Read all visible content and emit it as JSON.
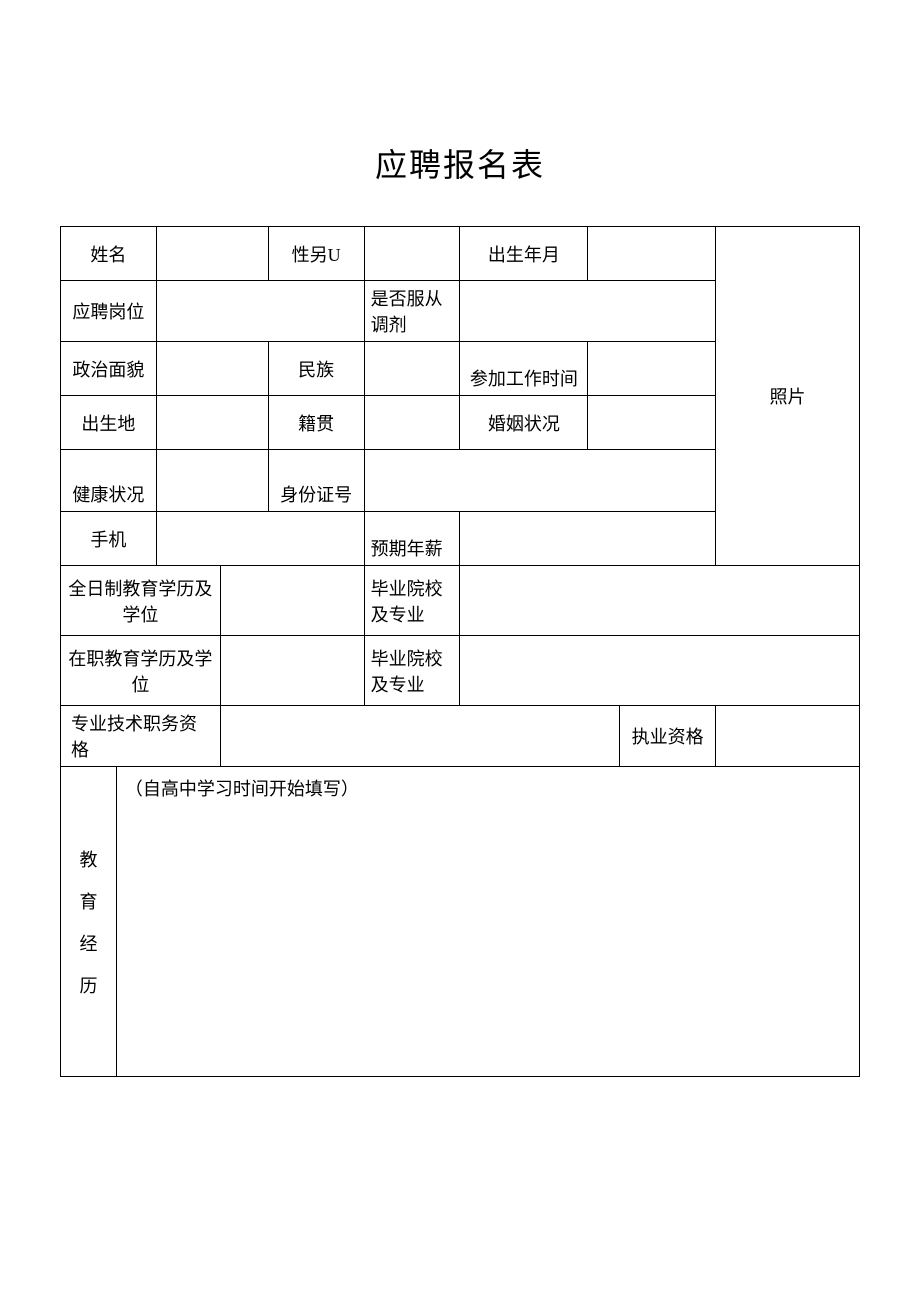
{
  "title": "应聘报名表",
  "labels": {
    "name": "姓名",
    "gender": "性另U",
    "birth": "出生年月",
    "position": "应聘岗位",
    "accept_transfer": "是否服从调剂",
    "political": "政治面貌",
    "ethnicity": "民族",
    "work_start": "参加工作时间",
    "birthplace": "出生地",
    "native_place": "籍贯",
    "marital": "婚姻状况",
    "health": "健康状况",
    "id_number": "身份证号",
    "mobile": "手机",
    "expected_salary": "预期年薪",
    "fulltime_edu": "全日制教育学历及学位",
    "grad_school": "毕业院校及专业",
    "onjob_edu": "在职教育学历及学位",
    "pro_title": "专业技术职务资格",
    "practice_qual": "执业资格",
    "edu_history": "教育经历",
    "edu_note": "（自高中学习时间开始填写）",
    "photo": "照片"
  },
  "values": {
    "name": "",
    "gender": "",
    "birth": "",
    "position": "",
    "accept_transfer": "",
    "political": "",
    "ethnicity": "",
    "work_start": "",
    "birthplace": "",
    "native_place": "",
    "marital": "",
    "health": "",
    "id_number": "",
    "mobile": "",
    "expected_salary": "",
    "fulltime_edu": "",
    "fulltime_grad": "",
    "onjob_edu": "",
    "onjob_grad": "",
    "pro_title": "",
    "practice_qual": "",
    "edu_history_content": ""
  }
}
